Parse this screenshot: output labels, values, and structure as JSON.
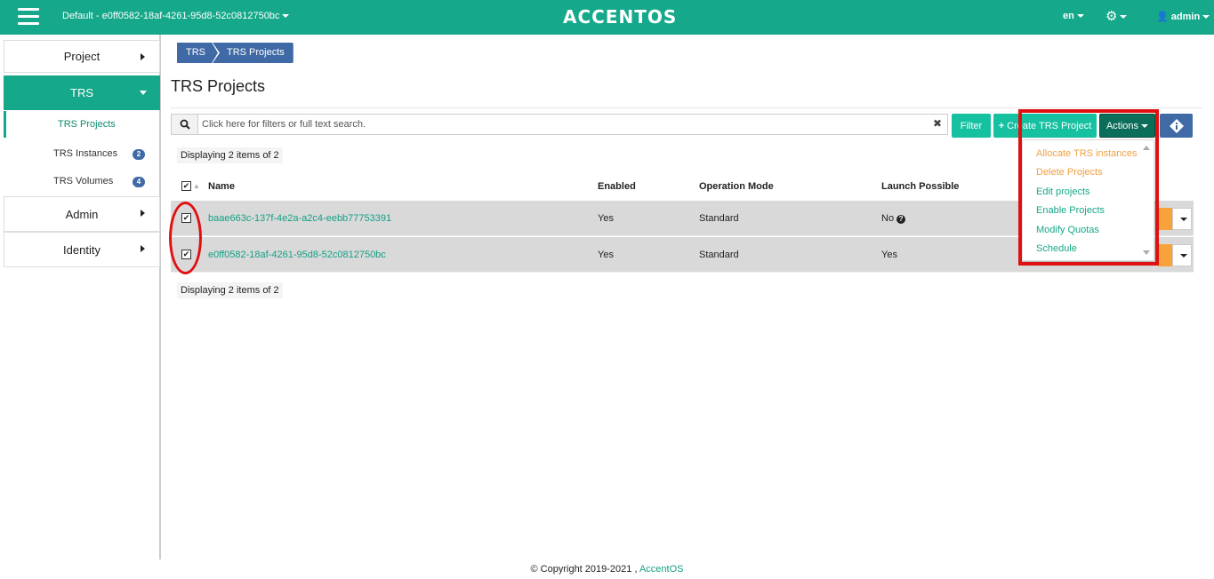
{
  "topbar": {
    "project_label": "Default - e0ff0582-18af-4261-95d8-52c0812750bc",
    "logo": "ACCENTOS",
    "language": "en",
    "user": "admin",
    "color": "#15a88a"
  },
  "sidebar": {
    "items": [
      {
        "label": "Project"
      },
      {
        "label": "TRS"
      },
      {
        "label": "Admin"
      },
      {
        "label": "Identity"
      }
    ],
    "sub_items": [
      {
        "label": "TRS Projects"
      },
      {
        "label": "TRS Instances",
        "badge": "2"
      },
      {
        "label": "TRS Volumes",
        "badge": "4"
      }
    ]
  },
  "breadcrumb": [
    "TRS",
    "TRS Projects"
  ],
  "page_title": "TRS Projects",
  "search": {
    "placeholder": "Click here for filters or full text search."
  },
  "toolbar": {
    "filter": "Filter",
    "create": "Create TRS Project",
    "actions": "Actions"
  },
  "table": {
    "count_text": "Displaying 2 items of 2",
    "columns": [
      "Name",
      "Enabled",
      "Operation Mode",
      "Launch Possible"
    ],
    "rows": [
      {
        "name": "baae663c-137f-4e2a-a2c4-eebb77753391",
        "enabled": "Yes",
        "mode": "Standard",
        "launch": "No"
      },
      {
        "name": "e0ff0582-18af-4261-95d8-52c0812750bc",
        "enabled": "Yes",
        "mode": "Standard",
        "launch": "Yes"
      }
    ]
  },
  "actions_menu": [
    {
      "label": "Allocate TRS instances"
    },
    {
      "label": "Delete Projects"
    },
    {
      "label": "Edit projects"
    },
    {
      "label": "Enable Projects"
    },
    {
      "label": "Modify Quotas"
    },
    {
      "label": "Schedule"
    }
  ],
  "footer": {
    "text": "© Copyright 2019-2021 , ",
    "link": "AccentOS"
  }
}
